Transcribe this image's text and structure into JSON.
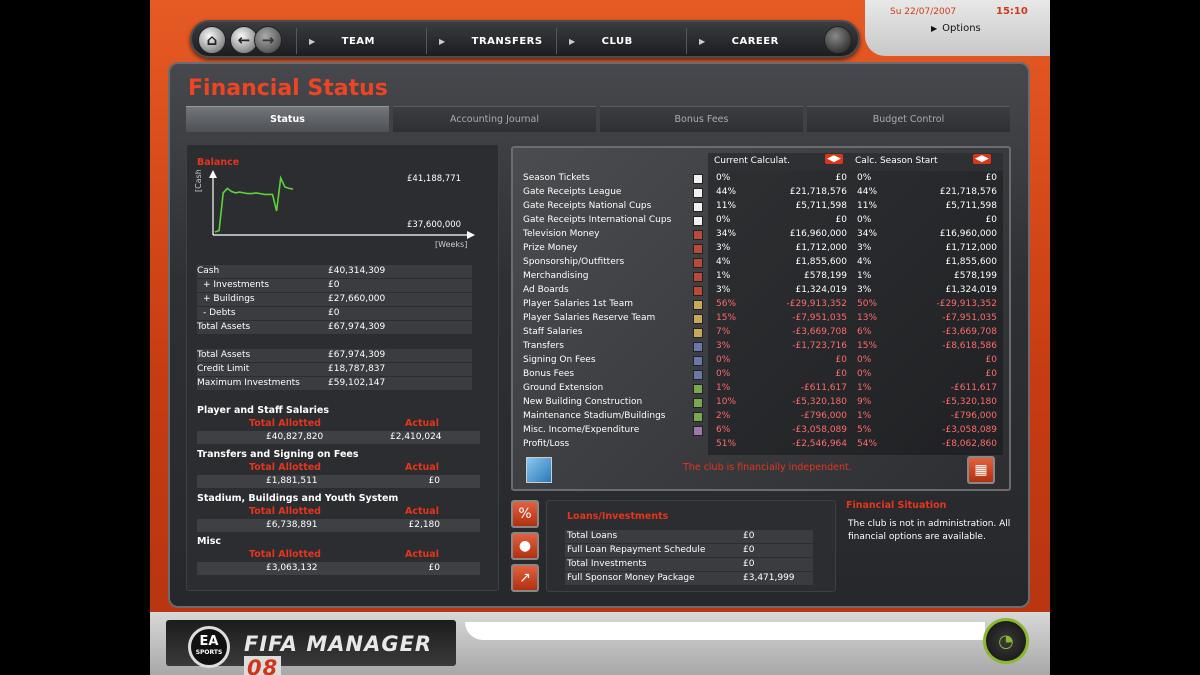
{
  "nav": {
    "tabs": [
      "TEAM",
      "TRANSFERS",
      "CLUB",
      "CAREER"
    ],
    "date": "Su 22/07/2007",
    "time": "15:10",
    "options_label": "Options"
  },
  "page_title": "Financial Status",
  "subtabs": [
    "Status",
    "Accounting Journal",
    "Bonus Fees",
    "Budget Control"
  ],
  "balance": {
    "label": "Balance",
    "y_axis_label": "[Cash]",
    "x_axis_label": "[Weeks]",
    "top_value": "£41,188,771",
    "bottom_value": "£37,600,000",
    "chart_data": {
      "type": "line",
      "ylim": [
        37600000,
        41188771
      ],
      "x": [
        0,
        1,
        2,
        3,
        4,
        5,
        6,
        7,
        8,
        9,
        10,
        11,
        12,
        13,
        14,
        15,
        16,
        17,
        18,
        19
      ],
      "values": [
        37600000,
        37700000,
        40200000,
        40500000,
        40300000,
        40200000,
        40250000,
        40200000,
        40150000,
        40150000,
        40200000,
        40150000,
        40100000,
        40100000,
        40100000,
        39000000,
        41188771,
        40600000,
        40500000,
        40450000
      ]
    }
  },
  "assets": [
    {
      "label": "Cash",
      "value": "£40,314,309"
    },
    {
      "label": "+ Investments",
      "value": "£0"
    },
    {
      "label": "+ Buildings",
      "value": "£27,660,000"
    },
    {
      "label": "- Debts",
      "value": "£0"
    },
    {
      "label": "Total Assets",
      "value": "£67,974,309"
    }
  ],
  "credit": [
    {
      "label": "Total Assets",
      "value": "£67,974,309"
    },
    {
      "label": "Credit Limit",
      "value": "£18,787,837"
    },
    {
      "label": "Maximum Investments",
      "value": "£59,102,147"
    }
  ],
  "budget_sections": [
    {
      "title": "Player and Staff Salaries",
      "allotted_label": "Total Allotted",
      "actual_label": "Actual",
      "allotted": "£40,827,820",
      "actual": "£2,410,024"
    },
    {
      "title": "Transfers and Signing on Fees",
      "allotted_label": "Total Allotted",
      "actual_label": "Actual",
      "allotted": "£1,881,511",
      "actual": "£0"
    },
    {
      "title": "Stadium, Buildings and Youth System",
      "allotted_label": "Total Allotted",
      "actual_label": "Actual",
      "allotted": "£6,738,891",
      "actual": "£2,180"
    },
    {
      "title": "Misc",
      "allotted_label": "Total Allotted",
      "actual_label": "Actual",
      "allotted": "£3,063,132",
      "actual": "£0"
    }
  ],
  "table": {
    "col1_header": "Current Calculat.",
    "col2_header": "Calc. Season Start",
    "rows": [
      {
        "label": "Season Tickets",
        "color": "#f0f0f0",
        "p1": "0%",
        "v1": "£0",
        "p2": "0%",
        "v2": "£0",
        "neg": false
      },
      {
        "label": "Gate Receipts League",
        "color": "#f0f0f0",
        "p1": "44%",
        "v1": "£21,718,576",
        "p2": "44%",
        "v2": "£21,718,576",
        "neg": false
      },
      {
        "label": "Gate Receipts National Cups",
        "color": "#f0f0f0",
        "p1": "11%",
        "v1": "£5,711,598",
        "p2": "11%",
        "v2": "£5,711,598",
        "neg": false
      },
      {
        "label": "Gate Receipts International Cups",
        "color": "#f0f0f0",
        "p1": "0%",
        "v1": "£0",
        "p2": "0%",
        "v2": "£0",
        "neg": false
      },
      {
        "label": "Television Money",
        "color": "#b84a3a",
        "p1": "34%",
        "v1": "£16,960,000",
        "p2": "34%",
        "v2": "£16,960,000",
        "neg": false
      },
      {
        "label": "Prize Money",
        "color": "#b84a3a",
        "p1": "3%",
        "v1": "£1,712,000",
        "p2": "3%",
        "v2": "£1,712,000",
        "neg": false
      },
      {
        "label": "Sponsorship/Outfitters",
        "color": "#b84a3a",
        "p1": "4%",
        "v1": "£1,855,600",
        "p2": "4%",
        "v2": "£1,855,600",
        "neg": false
      },
      {
        "label": "Merchandising",
        "color": "#b84a3a",
        "p1": "1%",
        "v1": "£578,199",
        "p2": "1%",
        "v2": "£578,199",
        "neg": false
      },
      {
        "label": "Ad Boards",
        "color": "#b84a3a",
        "p1": "3%",
        "v1": "£1,324,019",
        "p2": "3%",
        "v2": "£1,324,019",
        "neg": false
      },
      {
        "label": "Player Salaries 1st Team",
        "color": "#c8a85a",
        "p1": "56%",
        "v1": "-£29,913,352",
        "p2": "50%",
        "v2": "-£29,913,352",
        "neg": true
      },
      {
        "label": "Player Salaries Reserve Team",
        "color": "#c8a85a",
        "p1": "15%",
        "v1": "-£7,951,035",
        "p2": "13%",
        "v2": "-£7,951,035",
        "neg": true
      },
      {
        "label": "Staff Salaries",
        "color": "#c8a85a",
        "p1": "7%",
        "v1": "-£3,669,708",
        "p2": "6%",
        "v2": "-£3,669,708",
        "neg": true
      },
      {
        "label": "Transfers",
        "color": "#6a78a8",
        "p1": "3%",
        "v1": "-£1,723,716",
        "p2": "15%",
        "v2": "-£8,618,586",
        "neg": true
      },
      {
        "label": "Signing On Fees",
        "color": "#6a78a8",
        "p1": "0%",
        "v1": "£0",
        "p2": "0%",
        "v2": "£0",
        "neg": true
      },
      {
        "label": "Bonus Fees",
        "color": "#6a78a8",
        "p1": "0%",
        "v1": "£0",
        "p2": "0%",
        "v2": "£0",
        "neg": true
      },
      {
        "label": "Ground Extension",
        "color": "#7aa850",
        "p1": "1%",
        "v1": "-£611,617",
        "p2": "1%",
        "v2": "-£611,617",
        "neg": true
      },
      {
        "label": "New Building Construction",
        "color": "#7aa850",
        "p1": "10%",
        "v1": "-£5,320,180",
        "p2": "9%",
        "v2": "-£5,320,180",
        "neg": true
      },
      {
        "label": "Maintenance Stadium/Buildings",
        "color": "#7aa850",
        "p1": "2%",
        "v1": "-£796,000",
        "p2": "1%",
        "v2": "-£796,000",
        "neg": true
      },
      {
        "label": "Misc. Income/Expenditure",
        "color": "#9a7aa8",
        "p1": "6%",
        "v1": "-£3,058,089",
        "p2": "5%",
        "v2": "-£3,058,089",
        "neg": true
      },
      {
        "label": "Profit/Loss",
        "color": "",
        "p1": "51%",
        "v1": "-£2,546,964",
        "p2": "54%",
        "v2": "-£8,062,860",
        "neg": true
      }
    ],
    "status_text": "The club is financially independent."
  },
  "loans": {
    "title": "Loans/Investments",
    "rows": [
      {
        "label": "Total Loans",
        "value": "£0"
      },
      {
        "label": "Full Loan Repayment Schedule",
        "value": "£0"
      },
      {
        "label": "Total Investments",
        "value": "£0"
      },
      {
        "label": "Full Sponsor Money Package",
        "value": "£3,471,999"
      }
    ]
  },
  "financial_situation": {
    "title": "Financial Situation",
    "text": "The club is not in administration. All financial options are available."
  },
  "branding": {
    "ea": "EA",
    "ea_sub": "SPORTS",
    "game": "FIFA MANAGER",
    "game_num": "08"
  }
}
